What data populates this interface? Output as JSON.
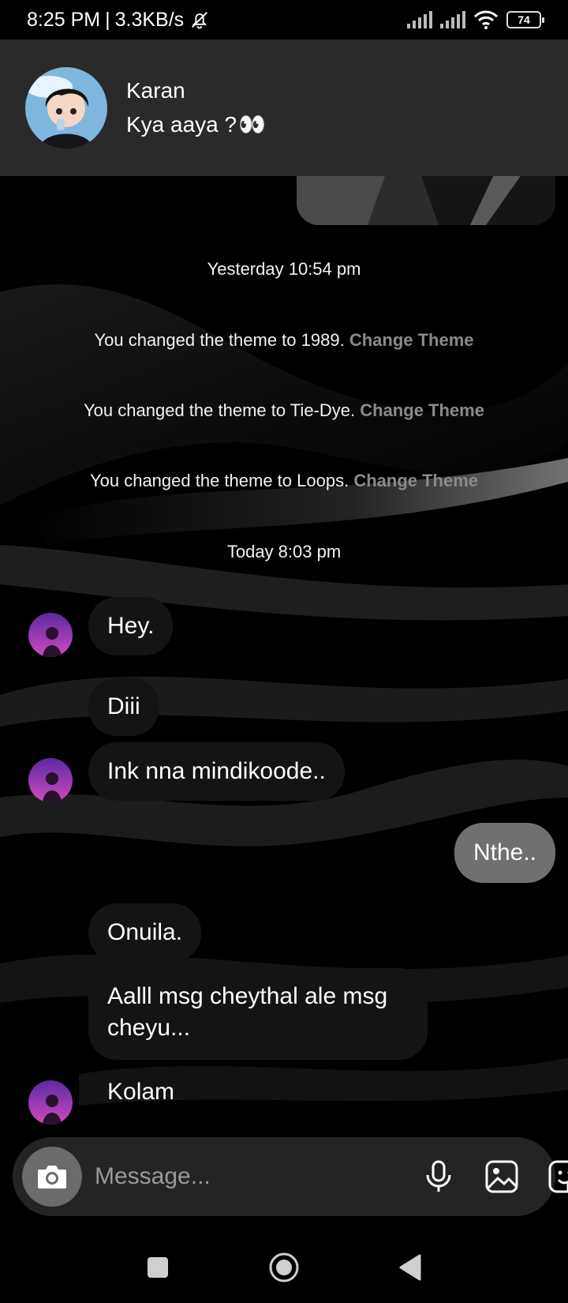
{
  "status_bar": {
    "time": "8:25 PM",
    "separator": "|",
    "net_speed": "3.3KB/s",
    "battery": "74"
  },
  "notification": {
    "sender": "Karan",
    "message": "Kya aaya ?",
    "emoji": "👀"
  },
  "thread": {
    "timestamp_1": "Yesterday 10:54 pm",
    "theme_events": [
      {
        "text": "You changed the theme to 1989.",
        "action": "Change Theme"
      },
      {
        "text": "You changed the theme to Tie-Dye.",
        "action": "Change Theme"
      },
      {
        "text": "You changed the theme to Loops.",
        "action": "Change Theme"
      }
    ],
    "timestamp_2": "Today 8:03 pm",
    "messages": [
      {
        "text": "Hey."
      },
      {
        "text": "Diii"
      },
      {
        "text": "Ink nna mindikoode.."
      },
      {
        "text": "Nthe.."
      },
      {
        "text": "Onuila."
      },
      {
        "text": "Aalll msg cheythal ale msg cheyu..."
      },
      {
        "text": "Kolam"
      }
    ]
  },
  "composer": {
    "placeholder": "Message..."
  },
  "colors": {
    "outgoing_bubble": "#707070",
    "incoming_bubble": "#141414",
    "action_link": "#8a8a8a",
    "banner_bg": "#2a2a2a"
  },
  "icons": [
    "bell-off-icon",
    "signal-icon",
    "wifi-icon",
    "battery-icon",
    "camera-icon",
    "microphone-icon",
    "gallery-icon",
    "sticker-icon",
    "recents-icon",
    "home-icon",
    "back-icon"
  ]
}
